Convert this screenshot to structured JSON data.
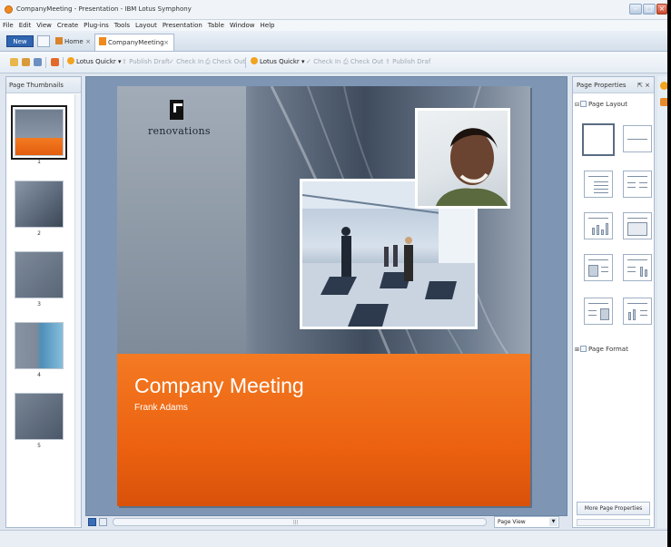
{
  "window": {
    "title": "CompanyMeeting - Presentation - IBM Lotus Symphony",
    "controls": {
      "minimize": "–",
      "maximize": "□",
      "close": "×"
    }
  },
  "menu": [
    "File",
    "Edit",
    "View",
    "Create",
    "Plug-ins",
    "Tools",
    "Layout",
    "Presentation",
    "Table",
    "Window",
    "Help"
  ],
  "tabs": {
    "new": "New",
    "home": "Home",
    "document": "CompanyMeeting",
    "close_glyph": "×"
  },
  "toolbar": {
    "lotus_quickr_1": "Lotus Quickr",
    "publish_draft_1": "Publish Draft",
    "check_in_1": "Check In",
    "check_out_1": "Check Out",
    "lotus_quickr_2": "Lotus Quickr",
    "check_in_2": "Check In",
    "check_out_2": "Check Out",
    "publish_draft_2": "Publish Draf"
  },
  "left_panel": {
    "title": "Page Thumbnails",
    "thumbnails": [
      "1",
      "2",
      "3",
      "4",
      "5"
    ]
  },
  "slide": {
    "logo_text": "renovations",
    "title": "Company Meeting",
    "subtitle": "Frank Adams"
  },
  "bottom": {
    "view_mode": "Page View"
  },
  "right_panel": {
    "title": "Page Properties",
    "header_controls": "⇱ ×",
    "section_layout": "Page Layout",
    "section_format": "Page Format",
    "more_button": "More Page Properties"
  },
  "colors": {
    "accent_orange": "#f47a22",
    "tab_blue": "#2f64b0",
    "canvas_bg": "#7e96b4"
  }
}
